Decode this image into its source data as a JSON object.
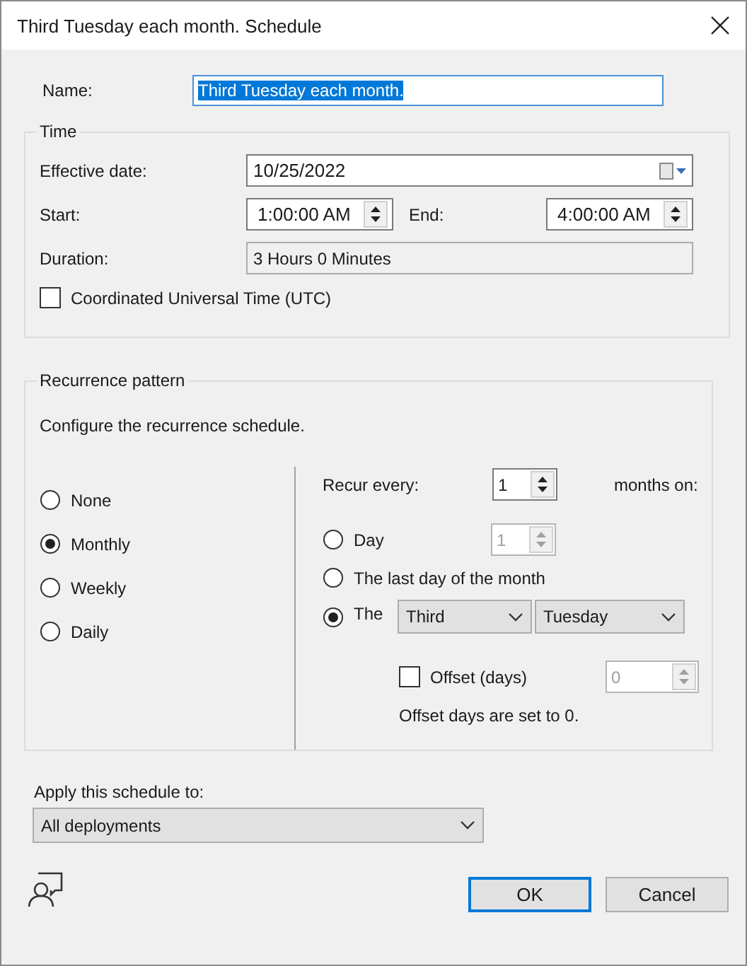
{
  "window": {
    "title": "Third Tuesday each month. Schedule"
  },
  "name": {
    "label": "Name:",
    "value": "Third Tuesday each month.",
    "selected": true
  },
  "time": {
    "title": "Time",
    "effective_date": {
      "label": "Effective date:",
      "value": "10/25/2022"
    },
    "start": {
      "label": "Start:",
      "value": "1:00:00 AM"
    },
    "end": {
      "label": "End:",
      "value": "4:00:00 AM"
    },
    "duration": {
      "label": "Duration:",
      "value": "3 Hours 0 Minutes"
    },
    "utc": {
      "label": "Coordinated Universal Time (UTC)",
      "checked": false
    }
  },
  "recurrence": {
    "title": "Recurrence pattern",
    "description": "Configure the recurrence schedule.",
    "patterns": [
      {
        "label": "None",
        "selected": false
      },
      {
        "label": "Monthly",
        "selected": true
      },
      {
        "label": "Weekly",
        "selected": false
      },
      {
        "label": "Daily",
        "selected": false
      }
    ],
    "recur_every": {
      "label": "Recur every:",
      "value": "1",
      "suffix": "months on:"
    },
    "options": [
      {
        "kind": "spin",
        "label": "Day",
        "selected": false,
        "value": "1",
        "disabled": true
      },
      {
        "kind": "plain",
        "label": "The last day of the month",
        "selected": false
      },
      {
        "kind": "dropdowns",
        "label": "The",
        "selected": true,
        "dropdowns": [
          "Third",
          "Tuesday"
        ]
      }
    ],
    "offset": {
      "label": "Offset (days)",
      "checked": false,
      "value": "0",
      "disabled": true,
      "note": "Offset days are set to 0."
    }
  },
  "apply": {
    "label": "Apply this schedule to:",
    "value": "All deployments"
  },
  "buttons": [
    {
      "label": "OK",
      "default": true
    },
    {
      "label": "Cancel",
      "default": false
    }
  ]
}
